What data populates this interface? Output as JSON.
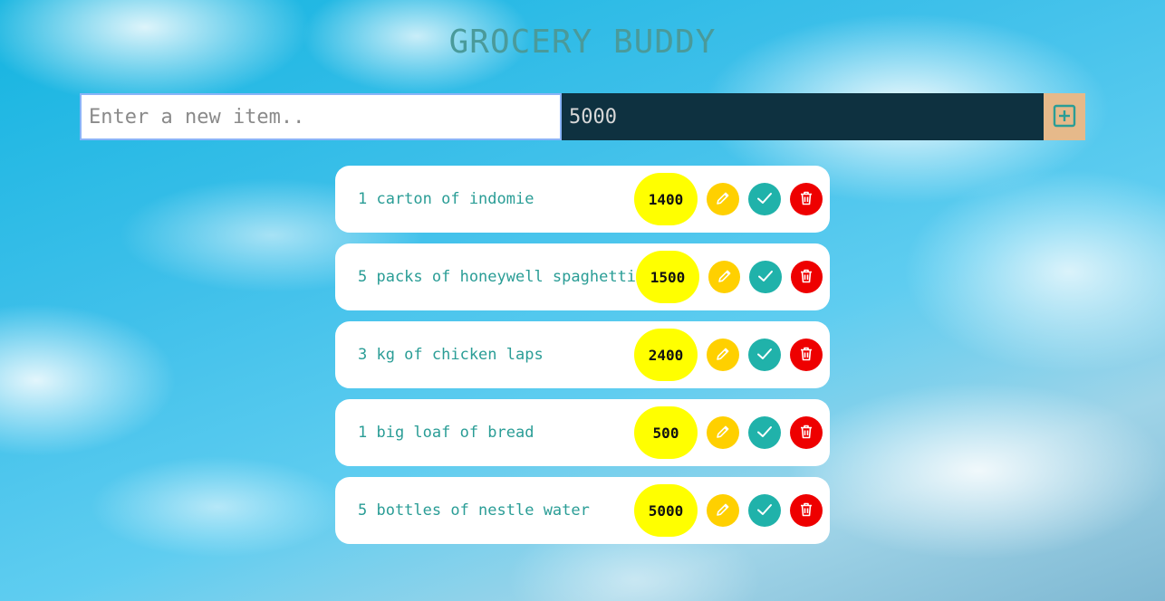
{
  "app": {
    "title": "GROCERY BUDDY"
  },
  "form": {
    "item_placeholder": "Enter a new item..",
    "item_value": "",
    "price_value": "5000",
    "add_icon": "plus-square-icon"
  },
  "items": [
    {
      "name": "1 carton of indomie",
      "price": "1400"
    },
    {
      "name": "5 packs of honeywell spaghetti",
      "price": "1500"
    },
    {
      "name": "3 kg of chicken laps",
      "price": "2400"
    },
    {
      "name": "1 big loaf of bread",
      "price": "500"
    },
    {
      "name": "5 bottles of nestle water",
      "price": "5000"
    }
  ],
  "row_icons": {
    "edit": "pencil-icon",
    "done": "check-icon",
    "delete": "trash-icon"
  },
  "colors": {
    "title": "#4a9a9a",
    "price_input_bg": "#0e3140",
    "add_button_bg": "#e6b98a",
    "item_text": "#2a9d96",
    "price_badge": "#ffff00",
    "edit_button": "#ffd000",
    "done_button": "#20b2aa",
    "delete_button": "#ee0000"
  }
}
